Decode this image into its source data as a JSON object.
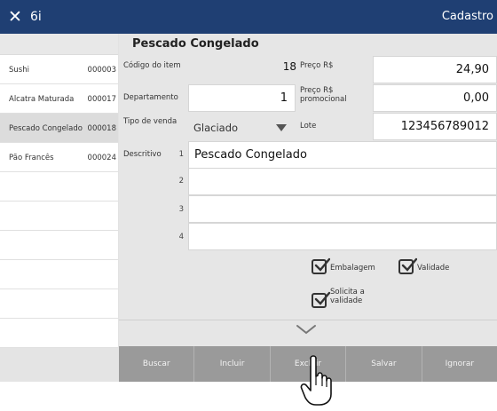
{
  "titlebar": {
    "close_icon": "close-icon",
    "app_name": "6i",
    "right_text": "Cadastro"
  },
  "sidebar": {
    "items": [
      {
        "name": "Sushi",
        "code": "000003",
        "selected": false
      },
      {
        "name": "Alcatra Maturada",
        "code": "000017",
        "selected": false
      },
      {
        "name": "Pescado Congelado",
        "code": "000018",
        "selected": true
      },
      {
        "name": "Pão Francês",
        "code": "000024",
        "selected": false
      }
    ]
  },
  "form": {
    "product_title": "Pescado Congelado",
    "codigo_label": "Código do item",
    "codigo_value": "18",
    "departamento_label": "Departamento",
    "departamento_value": "1",
    "tipo_venda_label": "Tipo de venda",
    "tipo_venda_value": "Glaciado",
    "preco_label": "Preço R$",
    "preco_value": "24,90",
    "preco_promo_label_1": "Preço R$",
    "preco_promo_label_2": "promocional",
    "preco_promo_value": "0,00",
    "lote_label": "Lote",
    "lote_value": "123456789012",
    "descritivo_label": "Descritivo",
    "descritivo_lines": [
      {
        "number": "1",
        "value": "Pescado Congelado"
      },
      {
        "number": "2",
        "value": ""
      },
      {
        "number": "3",
        "value": ""
      },
      {
        "number": "4",
        "value": ""
      }
    ],
    "checkboxes": {
      "embalagem": {
        "label": "Embalagem",
        "checked": true
      },
      "validade": {
        "label": "Validade",
        "checked": true
      },
      "solicita_line1": "Solicita a",
      "solicita_line2": "validade",
      "solicita_checked": true
    }
  },
  "actions": {
    "buscar": "Buscar",
    "incluir": "Incluir",
    "excluir": "Excluir",
    "salvar": "Salvar",
    "ignorar": "Ignorar"
  },
  "colors": {
    "titlebar": "#1f3f73",
    "panel": "#e6e6e6",
    "actionbar": "#9a9a9a"
  }
}
